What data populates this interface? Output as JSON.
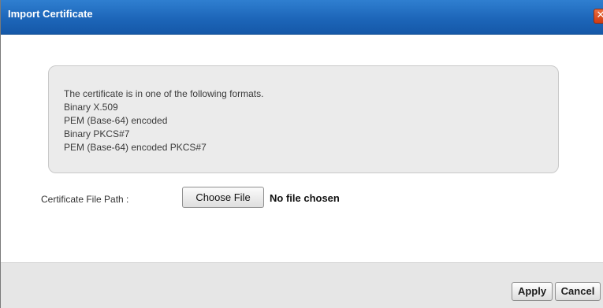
{
  "dialog": {
    "title": "Import Certificate",
    "close_symbol": "✕"
  },
  "info": {
    "lines": [
      "The certificate is in one of the following formats.",
      "Binary X.509",
      "PEM (Base-64) encoded",
      "Binary PKCS#7",
      "PEM (Base-64) encoded PKCS#7"
    ]
  },
  "file": {
    "label": "Certificate File Path :",
    "button_label": "Choose File",
    "status": "No file chosen"
  },
  "footer": {
    "apply_label": "Apply",
    "cancel_label": "Cancel"
  },
  "colors": {
    "title_bar": "#1d66b9",
    "close_button": "#d9481c",
    "info_box": "#ebebeb",
    "footer": "#e6e6e6"
  },
  "icons": {
    "close": "close-icon"
  }
}
